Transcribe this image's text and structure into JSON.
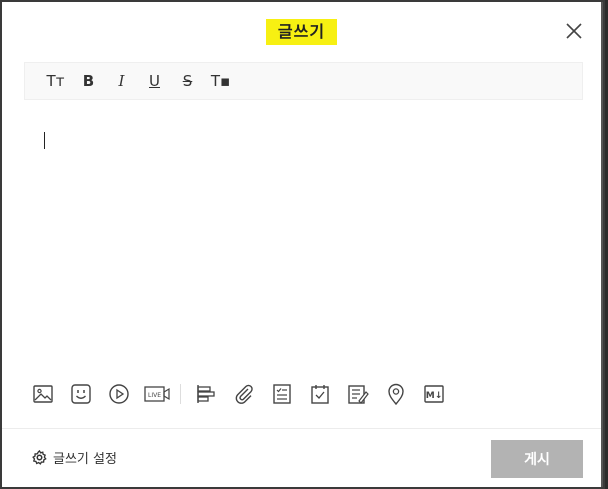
{
  "dialog": {
    "title": "글쓰기",
    "close_icon": "close-icon"
  },
  "format_toolbar": {
    "items": [
      {
        "name": "font-size",
        "glyph": "Tт"
      },
      {
        "name": "bold",
        "glyph": "B"
      },
      {
        "name": "italic",
        "glyph": "I"
      },
      {
        "name": "underline",
        "glyph": "U"
      },
      {
        "name": "strikethrough",
        "glyph": "S"
      },
      {
        "name": "clear-format",
        "glyph": "T▪"
      }
    ]
  },
  "insert_toolbar": {
    "icons": [
      "image-icon",
      "emoji-icon",
      "video-icon",
      "live-icon",
      "align-icon",
      "attach-icon",
      "checklist-icon",
      "calendar-icon",
      "poll-icon",
      "location-icon",
      "markdown-icon"
    ],
    "live_label": "LIVE",
    "markdown_label": "M↓"
  },
  "footer": {
    "settings_label": "글쓰기 설정",
    "post_label": "게시"
  },
  "colors": {
    "title_highlight": "#f7f012",
    "post_button_disabled": "#b3b3b3"
  }
}
